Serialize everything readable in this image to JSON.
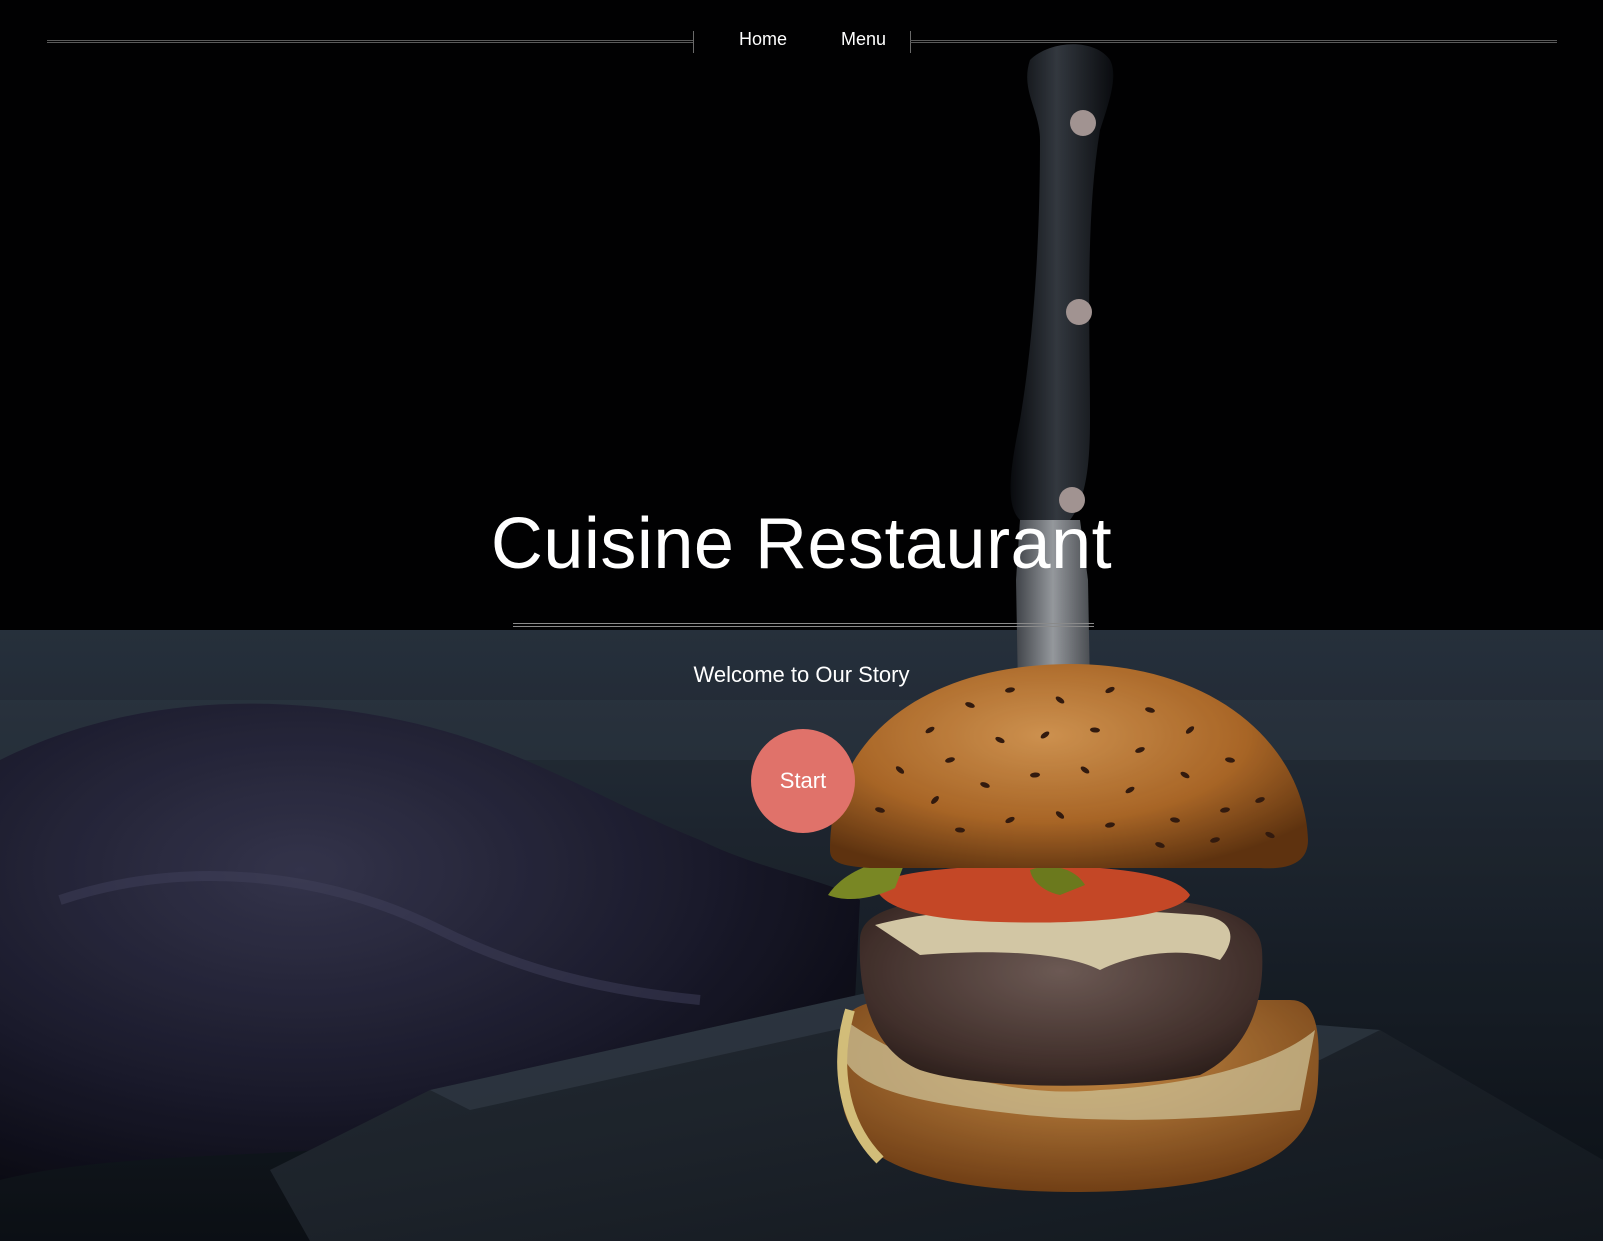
{
  "nav": {
    "items": [
      {
        "label": "Home"
      },
      {
        "label": "Menu"
      }
    ]
  },
  "hero": {
    "title": "Cuisine Restaurant",
    "subtitle": "Welcome to Our Story",
    "start_label": "Start",
    "image": "burger-with-knife-photo"
  },
  "colors": {
    "background": "#020203",
    "button": "#e0726a",
    "text": "#ffffff"
  }
}
